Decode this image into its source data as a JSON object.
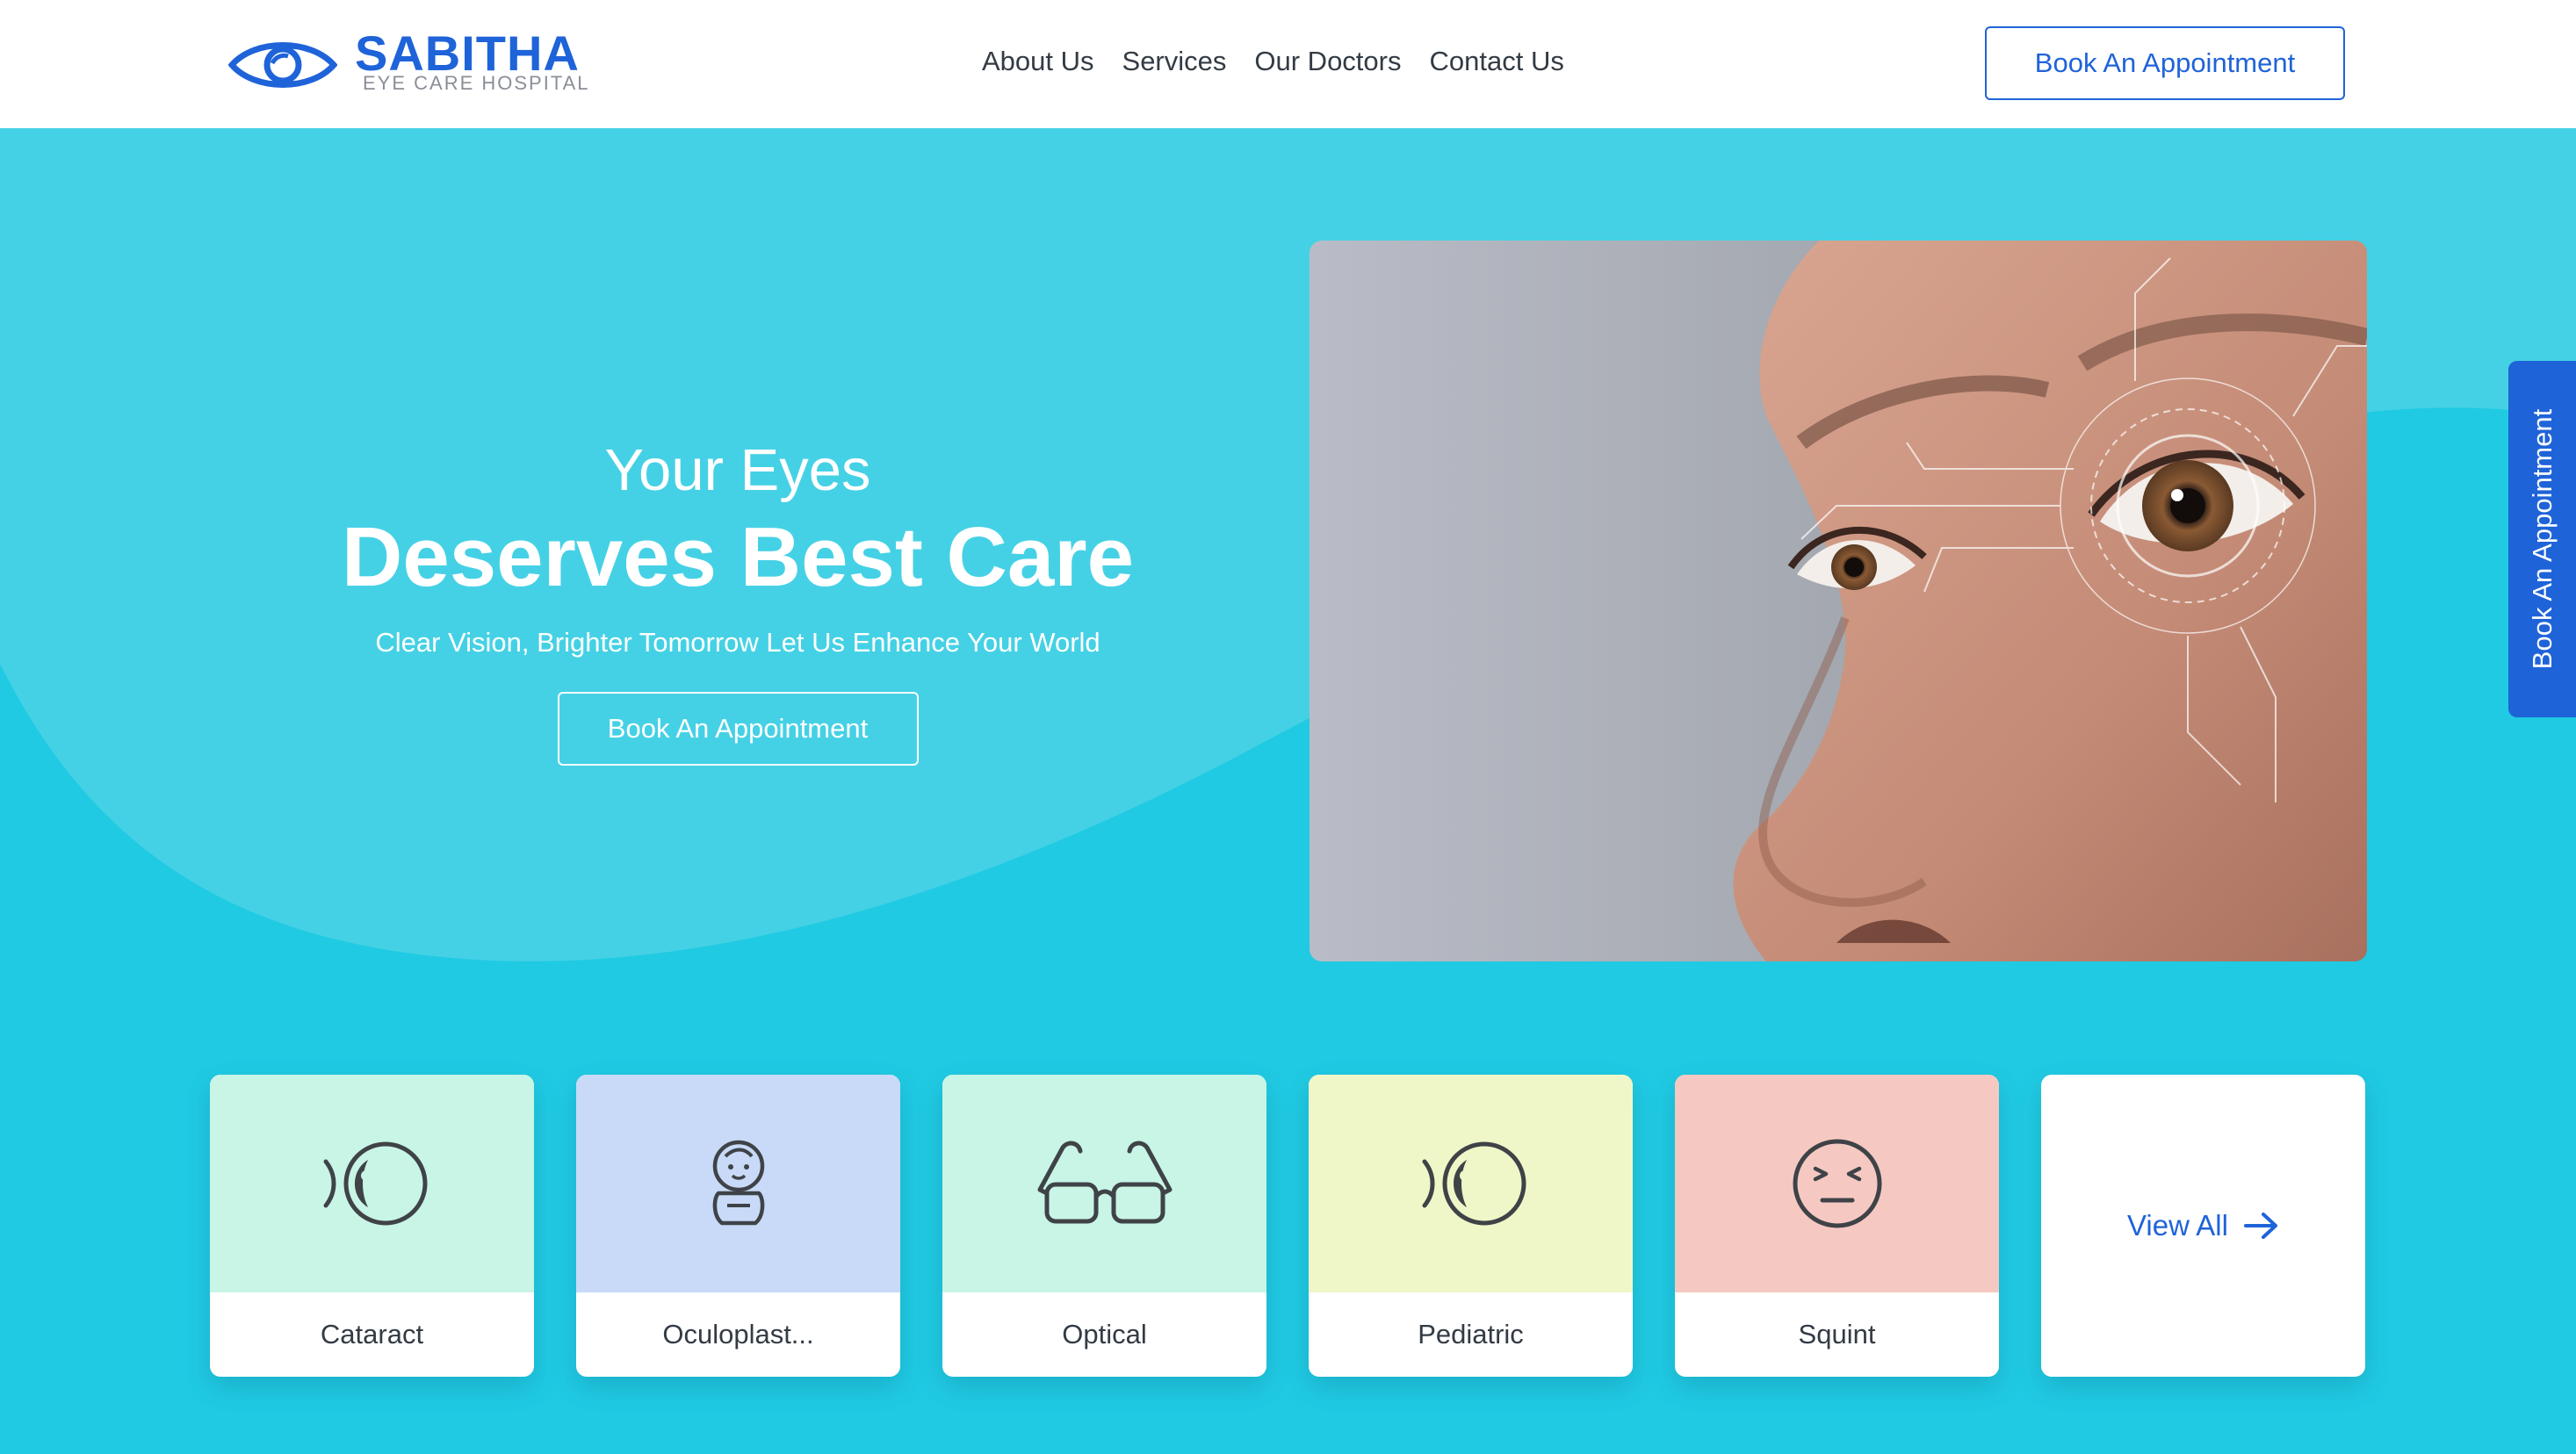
{
  "logo": {
    "name": "SABITHA",
    "subtitle": "EYE CARE HOSPITAL"
  },
  "nav": {
    "items": [
      "About Us",
      "Services",
      "Our Doctors",
      "Contact Us"
    ]
  },
  "header": {
    "cta_label": "Book An Appointment"
  },
  "hero": {
    "kicker": "Your Eyes",
    "title": "Deserves Best Care",
    "subtitle": "Clear Vision, Brighter Tomorrow Let Us Enhance Your World",
    "cta_label": "Book An Appointment"
  },
  "side_tab": {
    "label": "Book An Appointment"
  },
  "services": [
    {
      "label": "Cataract",
      "icon": "eye-profile-icon",
      "color": "#c8f5e5"
    },
    {
      "label": "Oculoplast...",
      "icon": "baby-icon",
      "color": "#c8daf7"
    },
    {
      "label": "Optical",
      "icon": "glasses-icon",
      "color": "#c8f5e5"
    },
    {
      "label": "Pediatric",
      "icon": "eye-profile-icon",
      "color": "#eff7c8"
    },
    {
      "label": "Squint",
      "icon": "squint-face-icon",
      "color": "#f5c9c2"
    }
  ],
  "view_all": {
    "label": "View All",
    "icon": "arrow-right-icon"
  },
  "colors": {
    "brand": "#1f63d9",
    "hero_bg": "#20cae3",
    "text_dark": "#333b44"
  }
}
